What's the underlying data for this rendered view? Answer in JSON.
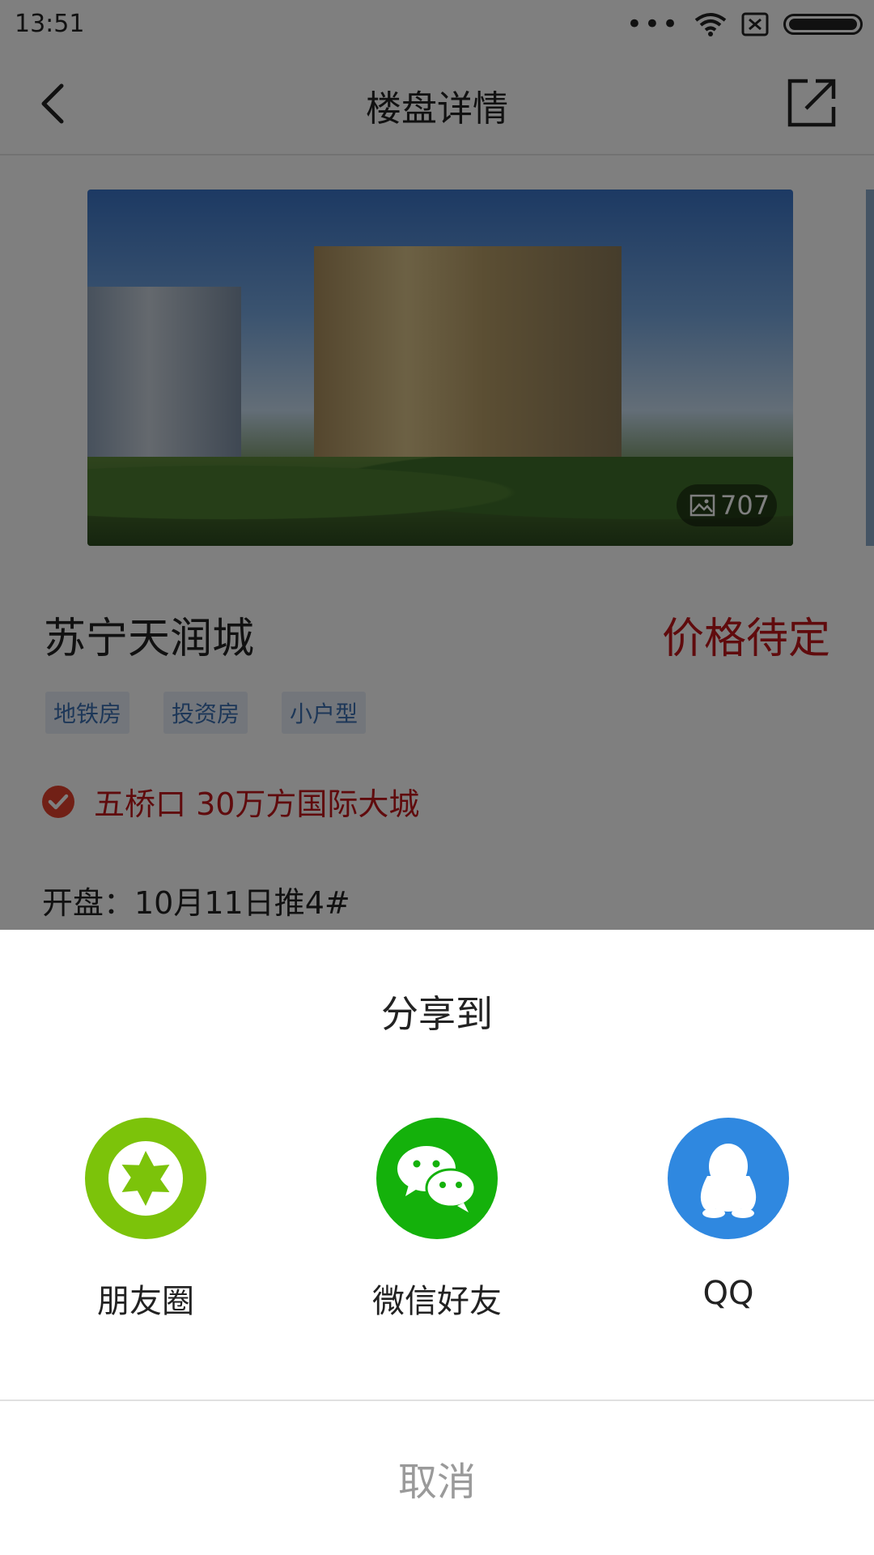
{
  "status": {
    "time": "13:51",
    "dots": "•••"
  },
  "nav": {
    "title": "楼盘详情"
  },
  "property": {
    "photo_count": "707",
    "name": "苏宁天润城",
    "price": "价格待定",
    "tags": [
      "地铁房",
      "投资房",
      "小户型"
    ],
    "feature": "五桥口 30万方国际大城",
    "opening": "开盘：10月11日推4#"
  },
  "share_sheet": {
    "title": "分享到",
    "options": [
      {
        "label": "朋友圈",
        "icon": "wechat-moments-icon",
        "color": "#7cc30a"
      },
      {
        "label": "微信好友",
        "icon": "wechat-icon",
        "color": "#14b10b"
      },
      {
        "label": "QQ",
        "icon": "qq-icon",
        "color": "#2f88e0"
      }
    ],
    "cancel": "取消"
  }
}
